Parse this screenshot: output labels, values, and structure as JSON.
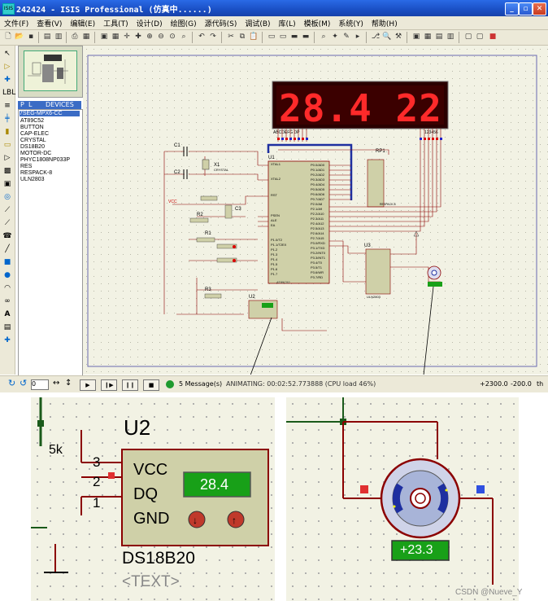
{
  "window": {
    "title": "242424 - ISIS Professional (仿真中......)",
    "app_icon": "isis-app-icon"
  },
  "menu": [
    "文件(F)",
    "查看(V)",
    "编辑(E)",
    "工具(T)",
    "设计(D)",
    "绘图(G)",
    "源代码(S)",
    "调试(B)",
    "库(L)",
    "模板(M)",
    "系统(Y)",
    "帮助(H)"
  ],
  "devices": {
    "tabs": [
      "P",
      "L",
      "DEVICES"
    ],
    "items": [
      "7SEG-MPX6-CC",
      "AT89C52",
      "BUTTON",
      "CAP-ELEC",
      "CRYSTAL",
      "DS18B20",
      "MOTOR-DC",
      "PHYC1808NP033P",
      "RES",
      "RESPACK-8",
      "ULN2803"
    ],
    "selected": "7SEG-MPX6-CC"
  },
  "schematic": {
    "display_text": "28.4  22",
    "display_pin_left": "ABCDEFG DP",
    "display_pin_right": "123456",
    "components": {
      "c1": "C1",
      "c2": "C2",
      "x1": "X1",
      "x1_sub": "CRYSTAL",
      "c3": "C3",
      "r1": "R1",
      "r2": "R2",
      "r3": "R3",
      "u1": "U1",
      "u1_part": "AT89C52",
      "u2": "U2",
      "u3": "U3",
      "u3_part": "ULN2803",
      "rp1": "RP1",
      "rp1_part": "RESPACK-8",
      "vcc": "VCC",
      "text_placeholder": "<TEXT>"
    },
    "u1_left_pins": [
      "XTAL1",
      "XTAL2",
      "RST",
      "PSEN",
      "ALE",
      "EA",
      "P1.0/T2",
      "P1.1/T2EX",
      "P1.2",
      "P1.3",
      "P1.4",
      "P1.5",
      "P1.6",
      "P1.7"
    ],
    "u1_right_pins": [
      "P0.0/AD0",
      "P0.1/AD1",
      "P0.2/AD2",
      "P0.3/AD3",
      "P0.4/AD4",
      "P0.5/AD5",
      "P0.6/AD6",
      "P0.7/AD7",
      "P2.0/A8",
      "P2.1/A9",
      "P2.2/A10",
      "P2.3/A11",
      "P2.4/A12",
      "P2.5/A13",
      "P2.6/A14",
      "P2.7/A15",
      "P3.0/RXD",
      "P3.1/TXD",
      "P3.2/INT0",
      "P3.3/INT1",
      "P3.4/T0",
      "P3.5/T1",
      "P3.6/WR",
      "P3.7/RD"
    ],
    "motor_reading": "+23.3",
    "sensor_reading": "28.4"
  },
  "statusbar": {
    "rotation": "0",
    "messages": "5 Message(s)",
    "animating": "ANIMATING: 00:02:52.773888 (CPU load 46%)",
    "coord_x": "+2300.0",
    "coord_y": "-200.0",
    "units": "th"
  },
  "zoom_sensor": {
    "part": "U2",
    "resistor_value": "5k",
    "pins": [
      "3",
      "2",
      "1"
    ],
    "pin_labels": [
      "VCC",
      "DQ",
      "GND"
    ],
    "reading": "28.4",
    "part_name": "DS18B20",
    "placeholder": "<TEXT>"
  },
  "zoom_motor": {
    "reading": "+23.3"
  },
  "watermark": "CSDN @Nueve_Y",
  "colors": {
    "wire": "#8b0000",
    "bus": "#1e2fa0",
    "part_fill": "#cfd0a8",
    "lcd_green": "#18a018",
    "seg_red": "#ff2a2a",
    "title_blue": "#1a4fc4"
  }
}
